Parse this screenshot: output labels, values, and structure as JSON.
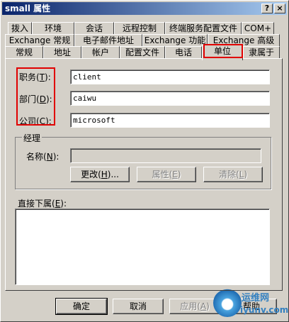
{
  "window": {
    "title": "small 属性",
    "help_glyph": "?",
    "close_glyph": "×"
  },
  "tabs": {
    "row1": [
      "拨入",
      "环境",
      "会话",
      "远程控制",
      "终端服务配置文件",
      "COM+"
    ],
    "row2": [
      "Exchange 常规",
      "电子邮件地址",
      "Exchange 功能",
      "Exchange 高级"
    ],
    "row3": [
      "常规",
      "地址",
      "帐户",
      "配置文件",
      "电话",
      "单位",
      "隶属于"
    ],
    "active": "单位"
  },
  "form": {
    "title": {
      "label": "职务",
      "key": "T",
      "value": "client"
    },
    "department": {
      "label": "部门",
      "key": "D",
      "value": "caiwu"
    },
    "company": {
      "label": "公司",
      "key": "C",
      "value": "microsoft"
    }
  },
  "manager": {
    "group_label": "经理",
    "name_label": "名称",
    "name_key": "N",
    "name_value": "",
    "change_button": "更改",
    "change_key": "H",
    "properties_button": "属性",
    "properties_key": "E",
    "clear_button": "清除",
    "clear_key": "L"
  },
  "direct_reports": {
    "label": "直接下属",
    "key": "E"
  },
  "footer": {
    "ok": "确定",
    "cancel": "取消",
    "apply": "应用",
    "apply_key": "A",
    "help": "帮助"
  },
  "watermark": {
    "line1": "运维网",
    "line2": "iyunv.com"
  },
  "colors": {
    "dialog_bg": "#d4d0c8",
    "titlebar_start": "#0a246a",
    "titlebar_end": "#a6caf0",
    "highlight_box": "#e00000",
    "watermark": "#3380c0"
  }
}
